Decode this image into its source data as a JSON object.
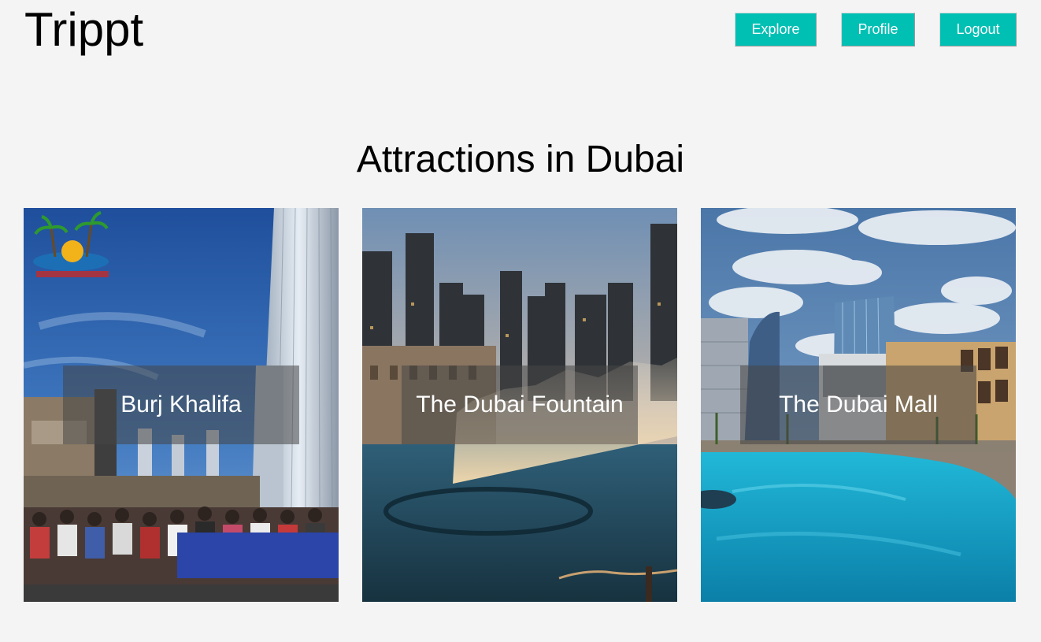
{
  "header": {
    "brand": "Trippt",
    "nav": {
      "explore": "Explore",
      "profile": "Profile",
      "logout": "Logout"
    }
  },
  "main": {
    "title": "Attractions in Dubai",
    "attractions": [
      {
        "name": "Burj Khalifa"
      },
      {
        "name": "The Dubai Fountain"
      },
      {
        "name": "The Dubai Mall"
      }
    ]
  },
  "colors": {
    "background": "#f4f4f4",
    "accent": "#00c0b4",
    "overlay": "rgba(70,70,70,0.55)"
  }
}
